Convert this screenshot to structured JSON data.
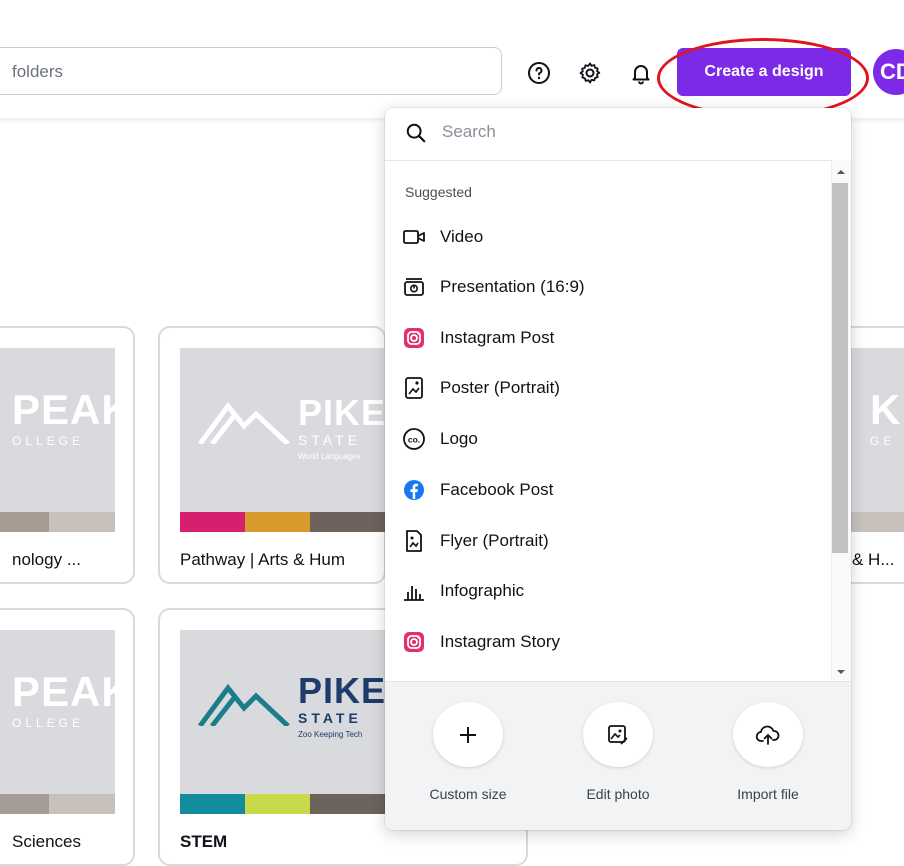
{
  "header": {
    "search_placeholder": "folders",
    "create_button": "Create a design",
    "avatar_initials": "CD"
  },
  "cards_row1": [
    {
      "title": "nology ...",
      "logo": "PEAK",
      "sub": "OLLEGE"
    },
    {
      "title": "Pathway | Arts & Hum",
      "logo": "PIKES",
      "sub": "STATE",
      "tagline": "World Languages"
    },
    {
      "title": "& H...",
      "logo": "K",
      "sub": "GE"
    }
  ],
  "cards_row2": [
    {
      "title": "Sciences",
      "logo": "PEAK",
      "sub": "OLLEGE"
    },
    {
      "title": "STEM",
      "logo": "PIKES",
      "sub": "STATE",
      "tagline": "Zoo Keeping Tech"
    }
  ],
  "dropdown": {
    "search_placeholder": "Search",
    "heading": "Suggested",
    "items": [
      {
        "label": "Video",
        "icon": "video-icon"
      },
      {
        "label": "Presentation (16:9)",
        "icon": "presentation-icon"
      },
      {
        "label": "Instagram Post",
        "icon": "instagram-icon"
      },
      {
        "label": "Poster (Portrait)",
        "icon": "poster-icon"
      },
      {
        "label": "Logo",
        "icon": "logo-icon"
      },
      {
        "label": "Facebook Post",
        "icon": "facebook-icon"
      },
      {
        "label": "Flyer (Portrait)",
        "icon": "flyer-icon"
      },
      {
        "label": "Infographic",
        "icon": "infographic-icon"
      },
      {
        "label": "Instagram Story",
        "icon": "instagram-icon"
      }
    ],
    "actions": [
      {
        "label": "Custom size",
        "icon": "plus-icon"
      },
      {
        "label": "Edit photo",
        "icon": "image-edit-icon"
      },
      {
        "label": "Import file",
        "icon": "cloud-upload-icon"
      }
    ]
  },
  "colors": {
    "brand_purple": "#7d2ae8",
    "annotation_red": "#e0141e",
    "instagram": "#e1306c",
    "facebook": "#1877f2"
  }
}
